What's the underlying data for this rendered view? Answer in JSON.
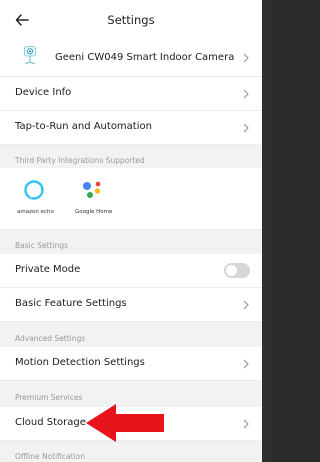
{
  "header": {
    "title": "Settings"
  },
  "device": {
    "name": "Geeni CW049 Smart Indoor Camera"
  },
  "menu": {
    "device_info": "Device Info",
    "tap_to_run": "Tap-to-Run and Automation"
  },
  "sections": {
    "third_party": "Third Party Integrations Supported",
    "basic": "Basic Settings",
    "advanced": "Advanced Settings",
    "premium": "Premium Services",
    "offline": "Offline Notification"
  },
  "integrations": {
    "alexa_caption": "amazon echo",
    "google_caption": "Google Home"
  },
  "basic": {
    "private_mode": "Private Mode",
    "private_mode_on": false,
    "basic_feature": "Basic Feature Settings"
  },
  "advanced": {
    "motion_detection": "Motion Detection Settings"
  },
  "premium": {
    "cloud_storage": "Cloud Storage"
  },
  "colors": {
    "alexa": "#31c4f3",
    "google_blue": "#4285f4",
    "google_red": "#ea4335",
    "google_yellow": "#fbbc05",
    "google_green": "#34a853",
    "arrow": "#e8141c"
  }
}
